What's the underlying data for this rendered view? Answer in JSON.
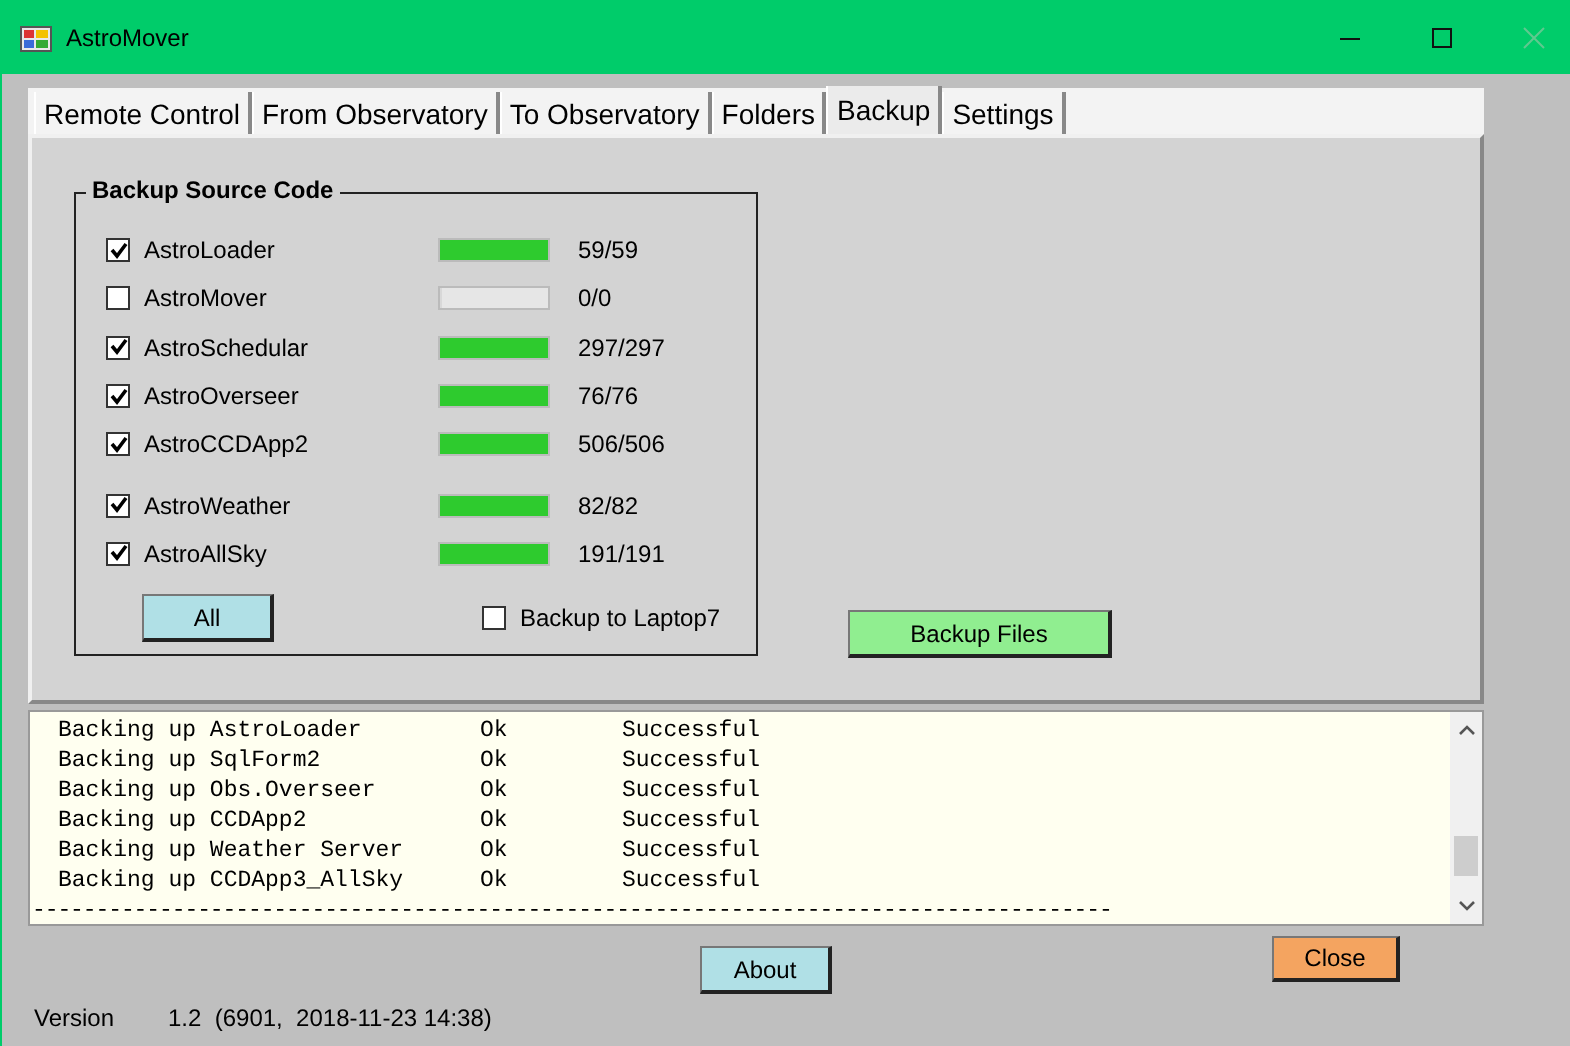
{
  "window": {
    "title": "AstroMover"
  },
  "tabs": [
    {
      "label": "Remote Control",
      "selected": false
    },
    {
      "label": "From Observatory",
      "selected": false
    },
    {
      "label": "To Observatory",
      "selected": false
    },
    {
      "label": "Folders",
      "selected": false
    },
    {
      "label": "Backup",
      "selected": true
    },
    {
      "label": "Settings",
      "selected": false
    }
  ],
  "backup_group": {
    "title": "Backup Source Code",
    "items": [
      {
        "name": "AstroLoader",
        "checked": true,
        "level": 1,
        "count": "59/59"
      },
      {
        "name": "AstroMover",
        "checked": false,
        "level": 0,
        "count": "0/0"
      },
      {
        "name": "AstroSchedular",
        "checked": true,
        "level": 1,
        "count": "297/297"
      },
      {
        "name": "AstroOverseer",
        "checked": true,
        "level": 1,
        "count": "76/76"
      },
      {
        "name": "AstroCCDApp2",
        "checked": true,
        "level": 1,
        "count": "506/506"
      },
      {
        "name": "AstroWeather",
        "checked": true,
        "level": 1,
        "count": "82/82"
      },
      {
        "name": "AstroAllSky",
        "checked": true,
        "level": 1,
        "count": "191/191"
      }
    ],
    "all_button": "All",
    "laptop_option": {
      "label": "Backup to Laptop7",
      "checked": false
    }
  },
  "backup_files_button": "Backup Files",
  "log": {
    "rows": [
      {
        "item": "Backing up AstroLoader",
        "status": "Ok",
        "result": "Successful"
      },
      {
        "item": "Backing up SqlForm2",
        "status": "Ok",
        "result": "Successful"
      },
      {
        "item": "Backing up Obs.Overseer",
        "status": "Ok",
        "result": "Successful"
      },
      {
        "item": "Backing up CCDApp2",
        "status": "Ok",
        "result": "Successful"
      },
      {
        "item": "Backing up Weather Server",
        "status": "Ok",
        "result": "Successful"
      },
      {
        "item": "Backing up CCDApp3_AllSky",
        "status": "Ok",
        "result": "Successful"
      }
    ],
    "separator": "-------------------------------------------------------------------------------------"
  },
  "about_button": "About",
  "close_button": "Close",
  "version": {
    "label": "Version",
    "value": "1.2  (6901,  2018-11-23 14:38)"
  }
}
